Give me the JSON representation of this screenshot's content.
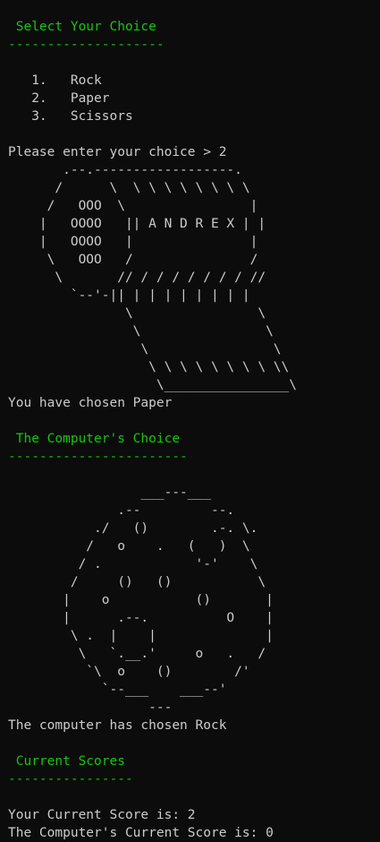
{
  "colors": {
    "background": "#0c0c0c",
    "text": "#cccccc",
    "heading": "#16c60c"
  },
  "menu": {
    "heading": " Select Your Choice",
    "rule": "--------------------",
    "options": [
      "   1.   Rock",
      "   2.   Paper",
      "   3.   Scissors"
    ]
  },
  "prompt": {
    "text": "Please enter your choice > 2"
  },
  "player_art": [
    "       .--.------------------.",
    "      /      \\  \\ \\ \\ \\ \\ \\ \\ \\",
    "     /   OOO  \\                |",
    "    |   OOOO   || A N D R E X | |",
    "    |   OOOO   |               |",
    "     \\   OOO   /               /",
    "      \\       // / / / / / / / //",
    "        `--'-|| | | | | | | | |",
    "               \\                \\",
    "                \\                \\",
    "                 \\                \\",
    "                  \\ \\ \\ \\ \\ \\ \\ \\ \\\\",
    "                   \\________________\\"
  ],
  "player_result": "You have chosen Paper",
  "computer": {
    "heading": " The Computer's Choice",
    "rule": "-----------------------"
  },
  "computer_art": [
    "                 ___---___",
    "              .--         --.",
    "           ./   ()        .-. \\.",
    "          /   o    .   (   )  \\",
    "         / .            '-'    \\",
    "        /     ()   ()           \\",
    "       |    o           ()       |",
    "       |      .--.          O    |",
    "        \\ .  |    |              |",
    "         \\   `.__.'     o   .   /",
    "          `\\  o    ()        /'",
    "            `--___    ___--'",
    "                  ---"
  ],
  "computer_result": "The computer has chosen Rock",
  "scores": {
    "heading": " Current Scores",
    "rule": "----------------",
    "player_line": "Your Current Score is: 2",
    "computer_line": "The Computer's Current Score is: 0"
  }
}
